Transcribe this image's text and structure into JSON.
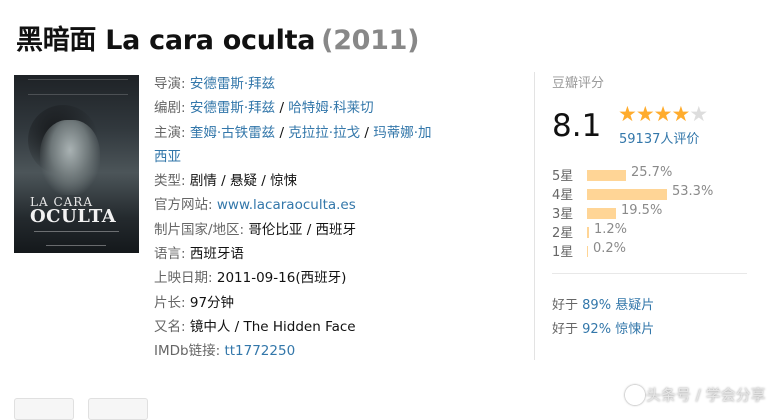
{
  "title": {
    "name": "黑暗面 La cara oculta",
    "year": "(2011)"
  },
  "poster": {
    "line1": "LA CARA",
    "line2": "OCULTA",
    "alt": "poster"
  },
  "info": {
    "director_label": "导演:",
    "director": "安德雷斯·拜兹",
    "writer_label": "编剧:",
    "writers": [
      "安德雷斯·拜兹",
      "哈特姆·科莱切"
    ],
    "cast_label": "主演:",
    "cast": [
      "奎姆·古铁雷兹",
      "克拉拉·拉戈",
      "玛蒂娜·加"
    ],
    "cast_wrap": "西亚",
    "genre_label": "类型:",
    "genres": [
      "剧情",
      "悬疑",
      "惊悚"
    ],
    "website_label": "官方网站:",
    "website": "www.lacaraoculta.es",
    "country_label": "制片国家/地区:",
    "country": "哥伦比亚 / 西班牙",
    "language_label": "语言:",
    "language": "西班牙语",
    "release_label": "上映日期:",
    "release": "2011-09-16(西班牙)",
    "runtime_label": "片长:",
    "runtime": "97分钟",
    "aka_label": "又名:",
    "aka": "镜中人 / The Hidden Face",
    "imdb_label": "IMDb链接:",
    "imdb": "tt1772250",
    "separator": " / "
  },
  "rating": {
    "label": "豆瓣评分",
    "score": "8.1",
    "stars": 4,
    "count": "59137人评价",
    "bars": [
      {
        "label": "5星",
        "percent": "25.7%",
        "value": 25.7
      },
      {
        "label": "4星",
        "percent": "53.3%",
        "value": 53.3
      },
      {
        "label": "3星",
        "percent": "19.5%",
        "value": 19.5
      },
      {
        "label": "2星",
        "percent": "1.2%",
        "value": 1.2
      },
      {
        "label": "1星",
        "percent": "0.2%",
        "value": 0.2
      }
    ]
  },
  "better_than": [
    {
      "prefix": "好于",
      "percent": "89%",
      "genre": "悬疑片"
    },
    {
      "prefix": "好于",
      "percent": "92%",
      "genre": "惊悚片"
    }
  ],
  "watermark": "头条号 / 学会分享"
}
